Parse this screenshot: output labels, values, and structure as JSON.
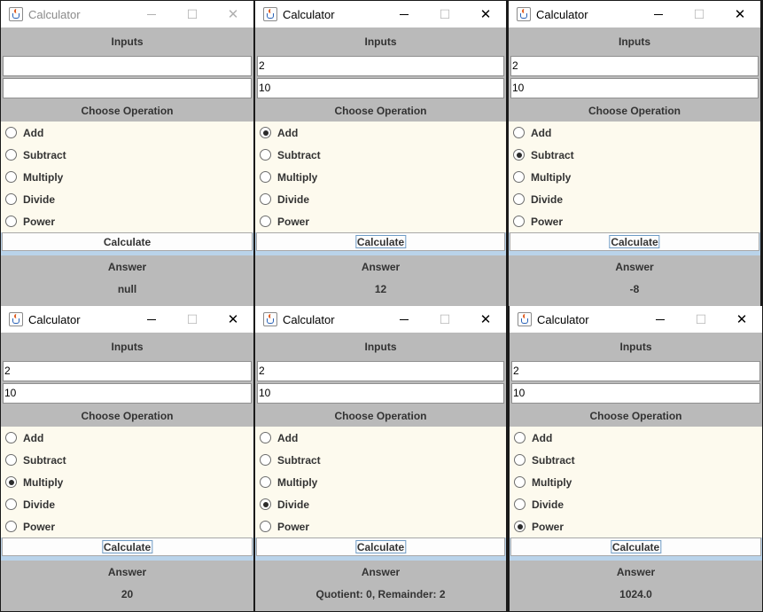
{
  "app_title": "Calculator",
  "labels": {
    "inputs": "Inputs",
    "choose_operation": "Choose Operation",
    "calculate": "Calculate",
    "answer": "Answer",
    "ops": [
      "Add",
      "Subtract",
      "Multiply",
      "Divide",
      "Power"
    ]
  },
  "windows": [
    {
      "input1": "",
      "input2": "",
      "selected": null,
      "answer": "null",
      "state": "inactive"
    },
    {
      "input1": "2",
      "input2": "10",
      "selected": "Add",
      "answer": "12",
      "state": "active"
    },
    {
      "input1": "2",
      "input2": "10",
      "selected": "Subtract",
      "answer": "-8",
      "state": "active"
    },
    {
      "input1": "2",
      "input2": "10",
      "selected": "Multiply",
      "answer": "20",
      "state": "active"
    },
    {
      "input1": "2",
      "input2": "10",
      "selected": "Divide",
      "answer": "Quotient: 0, Remainder: 2",
      "state": "active"
    },
    {
      "input1": "2",
      "input2": "10",
      "selected": "Power",
      "answer": "1024.0",
      "state": "active"
    }
  ],
  "icons": {
    "app": "java-cup-icon",
    "minimize": "minimize-icon",
    "maximize": "maximize-icon",
    "close": "close-icon"
  },
  "colors": {
    "panel_bg": "#bababa",
    "radio_bg": "#fdfaee",
    "calc_strip": "#b9d3ea",
    "title_bg": "#ffffff"
  }
}
